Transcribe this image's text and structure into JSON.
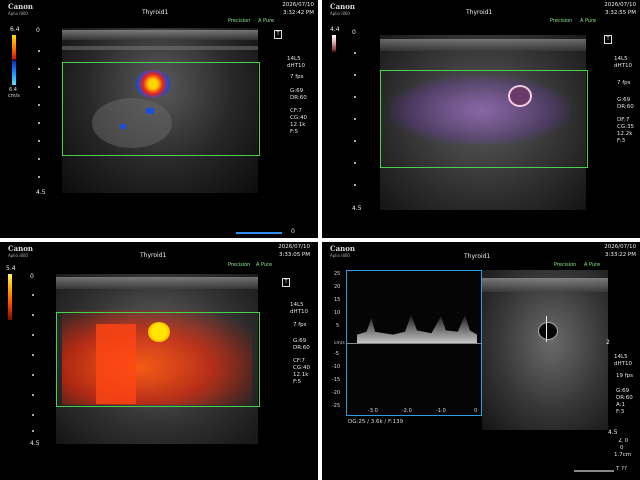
{
  "panels": [
    {
      "logo": "Canon",
      "model": "Aplio i800",
      "title": "Thyroid1",
      "date": "2026/07/10",
      "time": "3:32:42 PM",
      "mode": "Precision",
      "apure": "A Pure",
      "scale_top": "6.4",
      "scale_unit": "cm/s",
      "scale_bottom": "6.4",
      "probe": "14L5",
      "preset": "dHT10",
      "fps": "7 fps",
      "gain": "G:69",
      "dr": "DR:60",
      "cf": "CF:7",
      "cg": "CG:40",
      "prf": "12.1k",
      "filter": "F:5",
      "depth_top": "0",
      "depth_bottom": "4.5",
      "marker": "0",
      "colormap": "doppler"
    },
    {
      "logo": "Canon",
      "model": "Aplio i800",
      "title": "Thyroid1",
      "date": "2026/07/10",
      "time": "3:32:55 PM",
      "mode": "Precision",
      "apure": "A Pure",
      "scale_top": "4.4",
      "probe": "14L5",
      "preset": "dHT10",
      "fps": "7 fps",
      "gain": "G:69",
      "dr": "DR:60",
      "cf": "DF:7",
      "cg": "CG:35",
      "prf": "12.2k",
      "filter": "F:3",
      "depth_top": "0",
      "depth_bottom": "4.5",
      "colormap": "smi"
    },
    {
      "logo": "Canon",
      "model": "Aplio i800",
      "title": "Thyroid1",
      "date": "2026/07/10",
      "time": "3:33:05 PM",
      "mode": "Precision",
      "apure": "A Pure",
      "scale_top": "5.4",
      "probe": "14L5",
      "preset": "dHT10",
      "fps": "7 fps",
      "gain": "G:69",
      "dr": "DR:60",
      "cf": "CF:7",
      "cg": "CG:40",
      "prf": "12.1k",
      "filter": "F:5",
      "depth_top": "0",
      "depth_bottom": "4.5",
      "colormap": "power"
    },
    {
      "logo": "Canon",
      "model": "Aplio i800",
      "title": "Thyroid1",
      "date": "2026/07/10",
      "time": "3:33:22 PM",
      "mode": "Precision",
      "apure": "A Pure",
      "spectral_unit": "cm/s",
      "spectral_y_ticks": [
        "25",
        "20",
        "15",
        "10",
        "5",
        "",
        "-5",
        "-10",
        "-15",
        "-20",
        "-25"
      ],
      "spectral_x_ticks": [
        "-3.0",
        "-2.0",
        "-1.0",
        "0"
      ],
      "spectral_footer": "DG:25 / 3.6k  / F:139",
      "probe": "14L5",
      "preset": "dHT10",
      "fps": "19 fps",
      "gain": "G:69",
      "dr": "DR:60",
      "ar": "A:1",
      "filter": "F:3",
      "depth_top": "2",
      "depth_bottom": "4.5",
      "angle": "∠ 0",
      "sv": "0",
      "sv_size": "1.7cm",
      "corner": "T ??"
    }
  ],
  "colors": {
    "roi": "#4bd04b",
    "doppler_red": "#e8231a",
    "doppler_yellow": "#ffd400",
    "doppler_blue": "#1a4fd8",
    "power_orange": "#ff5a10",
    "smi_purple": "#b26ee6"
  }
}
